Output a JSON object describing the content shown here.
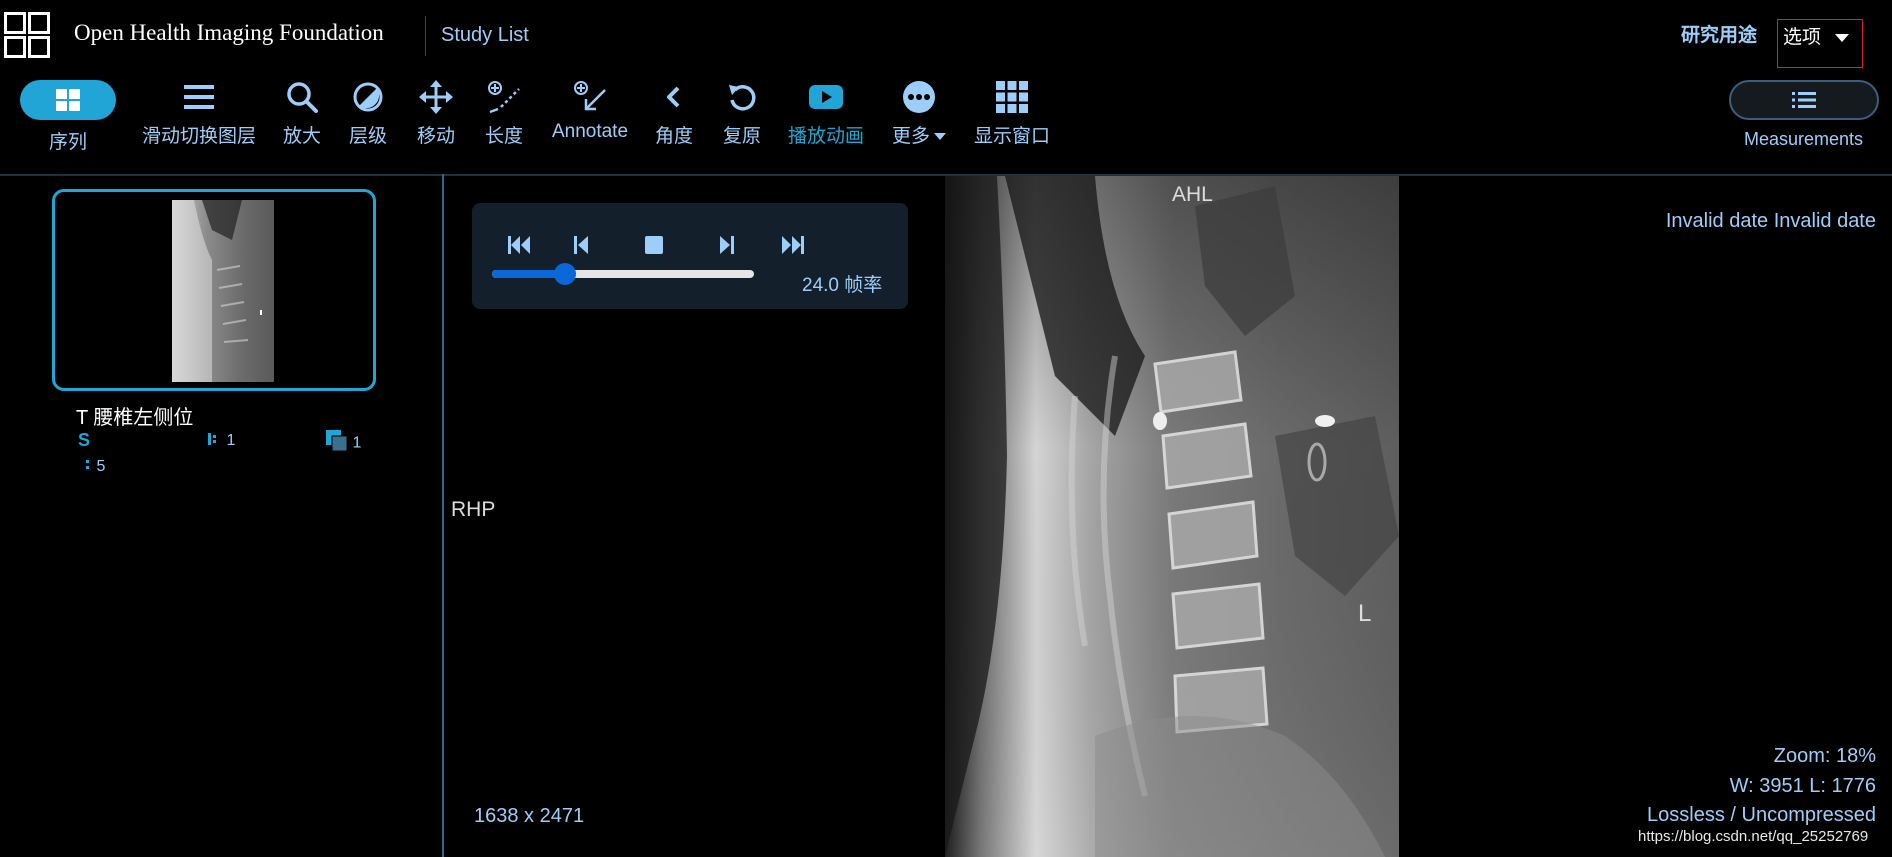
{
  "header": {
    "brand": "Open Health Imaging Foundation",
    "study_list": "Study List",
    "research": "研究用途",
    "options": "选项"
  },
  "toolbar": {
    "series": "序列",
    "stack_scroll": "滑动切换图层",
    "zoom": "放大",
    "levels": "层级",
    "pan": "移动",
    "length": "长度",
    "annotate": "Annotate",
    "angle": "角度",
    "reset": "复原",
    "cine": "播放动画",
    "more": "更多",
    "layout": "显示窗口",
    "measurements": "Measurements",
    "active_color": "#20a5d6"
  },
  "series_panel": {
    "name": "T 腰椎左侧位",
    "modality": "S",
    "series_number": "1",
    "instance_count": "1",
    "number": "5"
  },
  "viewport": {
    "top_marker": "AHL",
    "left_marker": "RHP",
    "right_marker": "L",
    "date": "Invalid date Invalid date",
    "dimensions": "1638 x 2471",
    "zoom": "Zoom: 18%",
    "window_level": "W: 3951 L: 1776",
    "compression": "Lossless / Uncompressed"
  },
  "cine": {
    "fps_label": "24.0 帧率",
    "slider_fraction": 0.28
  },
  "watermark": "https://blog.csdn.net/qq_25252769"
}
